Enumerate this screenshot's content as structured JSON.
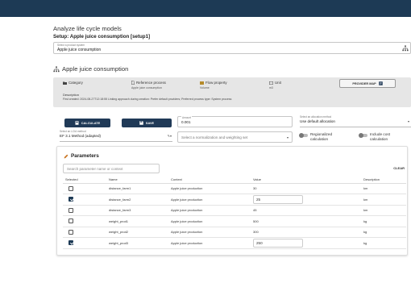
{
  "page": {
    "title": "Analyze life cycle models",
    "subtitle": "Setup: Apple juice consumption [setup1]"
  },
  "product_system": {
    "label": "Select a product system",
    "value": "Apple juice consumption"
  },
  "section_title": "Apple juice consumption",
  "info": {
    "category_label": "Category",
    "ref_process_label": "Reference process",
    "ref_process_value": "Apple juice consumption",
    "flow_property_label": "Flow property",
    "flow_property_value": "Volume",
    "unit_label": "Unit",
    "unit_value": "m3",
    "provider_map": "PROVIDER MAP",
    "description_label": "Description",
    "description_text": "First created: 2024-08-27T12:18:55 Linking approach during creation: Prefer default providers; Preferred process type: System process"
  },
  "actions": {
    "calculate": "CALCULATE",
    "save": "SAVE"
  },
  "amount": {
    "label": "Amount",
    "value": "0.001"
  },
  "allocation": {
    "label": "Select an allocation method",
    "value": "Use default allocation"
  },
  "lcia": {
    "label": "Select an LCIA method",
    "value": "EF 3.1 Method (adapted)"
  },
  "nw_set": {
    "placeholder": "Select a normalization and weighting set"
  },
  "toggles": {
    "regionalized": "Regionalized calculation",
    "cost": "Include cost calculation"
  },
  "parameters": {
    "title": "Parameters",
    "search_placeholder": "Search parameter name or context",
    "clear": "CLEAR",
    "columns": [
      "Selected",
      "Name",
      "Context",
      "Value",
      "Description"
    ],
    "rows": [
      {
        "selected": false,
        "name": "distance_farm1",
        "context": "Apple juice production",
        "value": "30",
        "description": "km"
      },
      {
        "selected": true,
        "name": "distance_farm2",
        "context": "Apple juice production",
        "value": "25",
        "description": "km"
      },
      {
        "selected": false,
        "name": "distance_farm3",
        "context": "Apple juice production",
        "value": "45",
        "description": "km"
      },
      {
        "selected": false,
        "name": "weight_prod1",
        "context": "Apple juice production",
        "value": "500",
        "description": "kg"
      },
      {
        "selected": false,
        "name": "weight_prod2",
        "context": "Apple juice production",
        "value": "300",
        "description": "kg"
      },
      {
        "selected": true,
        "name": "weight_prod3",
        "context": "Apple juice production",
        "value": "250",
        "description": "kg"
      }
    ]
  }
}
